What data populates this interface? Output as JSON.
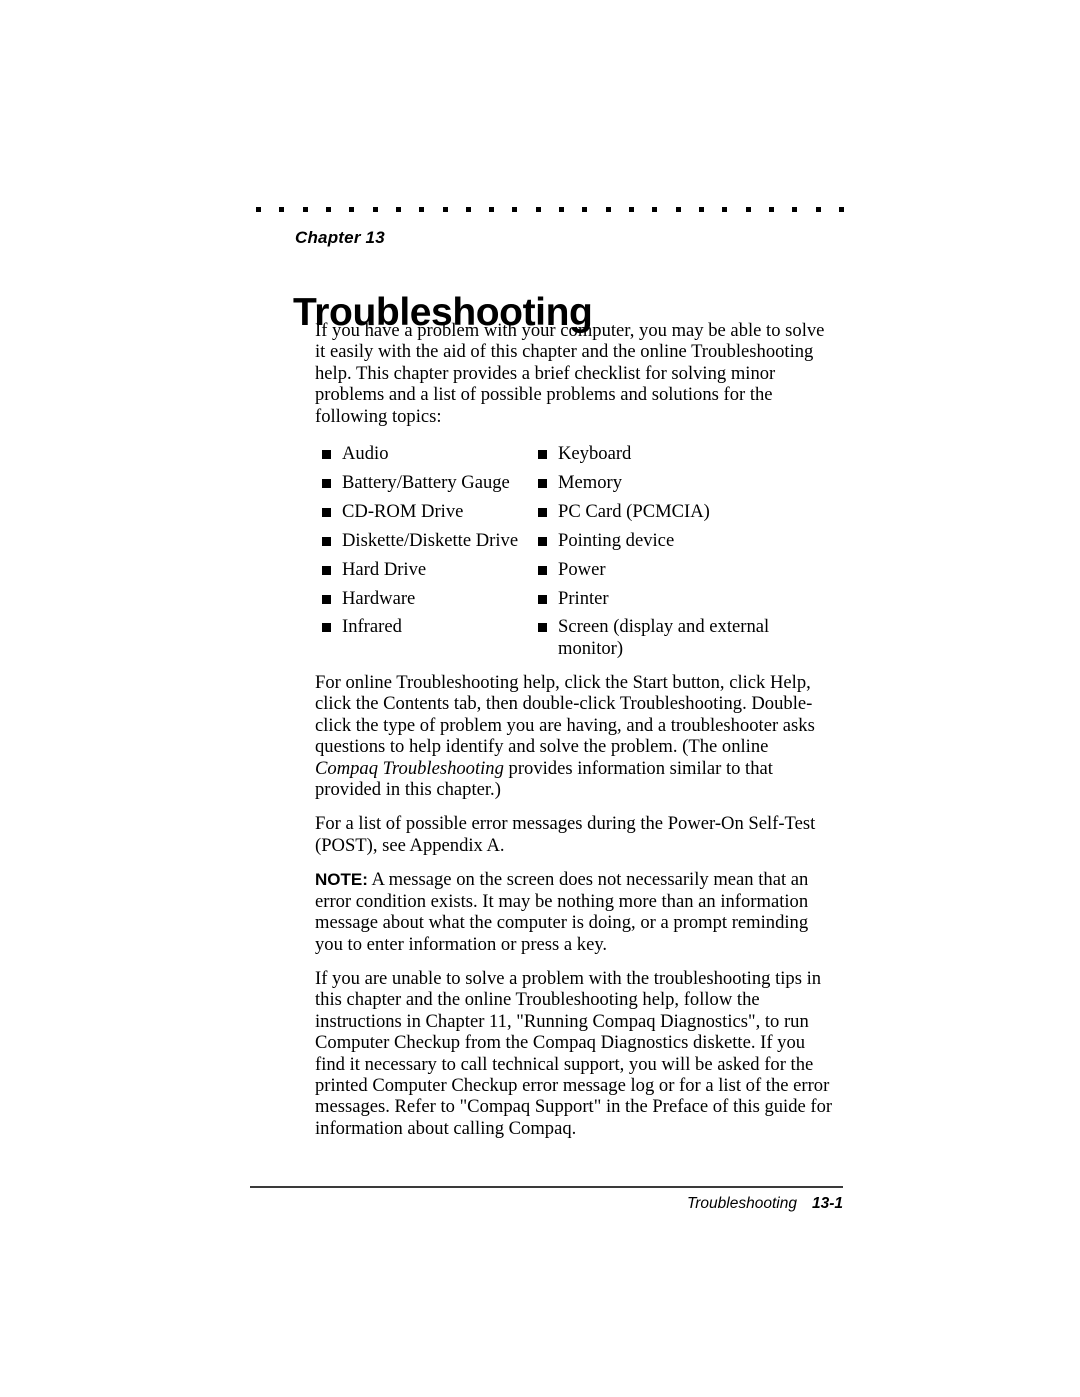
{
  "document": {
    "chapter_label": "Chapter 13",
    "title": "Troubleshooting"
  },
  "intro": {
    "paragraph": "If you have a problem with your computer, you may be able to solve it easily with the aid of this chapter and the online Troubleshooting help. This chapter provides a brief checklist for solving minor problems and a list of possible problems and solutions for the following topics:"
  },
  "topics": {
    "left_column": [
      "Audio",
      "Battery/Battery Gauge",
      "CD-ROM Drive",
      "Diskette/Diskette Drive",
      "Hard Drive",
      "Hardware",
      "Infrared"
    ],
    "right_column": [
      "Keyboard",
      "Memory",
      "PC Card (PCMCIA)",
      "Pointing device",
      "Power",
      "Printer",
      "Screen (display and external monitor)"
    ]
  },
  "online_help": {
    "part1": "For online Troubleshooting help, click the Start button, click Help, click the Contents tab, then double-click Troubleshooting. Double-click the type of problem you are having, and a troubleshooter asks questions to help identify and solve the problem. (The online ",
    "italic1": "Compaq Troubleshooting",
    "part2": " provides information similar to that provided in this chapter.)"
  },
  "post_messages": {
    "paragraph": "For a list of possible error messages during the Power-On Self-Test (POST), see Appendix A."
  },
  "note": {
    "label": "NOTE:",
    "text": " A message on the screen does not necessarily mean that an error condition exists. It may be nothing more than an information message about what the computer is doing, or a prompt reminding you to enter information or press a key."
  },
  "diagnostics": {
    "paragraph": "If you are unable to solve a problem with the troubleshooting tips in this chapter and the online Troubleshooting help, follow the instructions in Chapter 11, \"Running Compaq Diagnostics\", to run Computer Checkup from the Compaq Diagnostics diskette. If you find it necessary to call technical support, you will be asked for the printed Computer Checkup error message log or for a list of the error messages. Refer to \"Compaq Support\" in the Preface of this guide for information about calling Compaq."
  },
  "footer": {
    "chapter_name": "Troubleshooting",
    "page_number": "13-1"
  },
  "style": {
    "ink": "#000000",
    "paper": "#ffffff",
    "rule": "#3a3a3a"
  }
}
